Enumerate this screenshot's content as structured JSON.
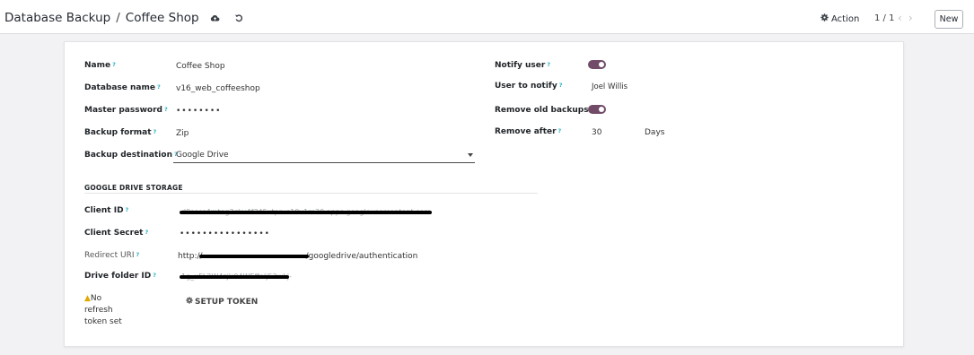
{
  "breadcrumb": {
    "parent": "Database Backup",
    "separator": "/",
    "current": "Coffee Shop"
  },
  "toolbar": {
    "action_label": "Action",
    "pager": "1 / 1",
    "new_label": "New",
    "icons": [
      "cloud-upload-icon",
      "undo-icon",
      "gear-icon",
      "chevron-left-icon",
      "chevron-right-icon"
    ]
  },
  "form": {
    "name_label": "Name",
    "name_value": "Coffee Shop",
    "db_label": "Database name",
    "db_value": "v16_web_coffeeshop",
    "master_label": "Master password",
    "master_value": "••••••••",
    "format_label": "Backup format",
    "format_value": "Zip",
    "dest_label": "Backup destination",
    "dest_value": "Google Drive",
    "notify_label": "Notify user",
    "notify_on": true,
    "user_notify_label": "User to notify",
    "user_notify_value": "Joel Willis",
    "remove_old_label": "Remove old backups",
    "remove_old_on": true,
    "remove_after_label": "Remove after",
    "remove_after_value": "30",
    "remove_after_unit": "Days",
    "help_mark": "?"
  },
  "drive": {
    "section_title": "GOOGLE DRIVE STORAGE",
    "client_id_label": "Client ID",
    "client_secret_label": "Client Secret",
    "client_secret_value": "••••••••••••••••",
    "redirect_label": "Redirect URI",
    "redirect_prefix": "http://",
    "redirect_suffix": "/googledrive/authentication",
    "folder_label": "Drive folder ID",
    "warning_text": "No refresh token set",
    "setup_token_label": "SETUP TOKEN"
  },
  "colors": {
    "toggle": "#714b67",
    "help": "#2cb2bf",
    "warning": "#e0a800"
  }
}
